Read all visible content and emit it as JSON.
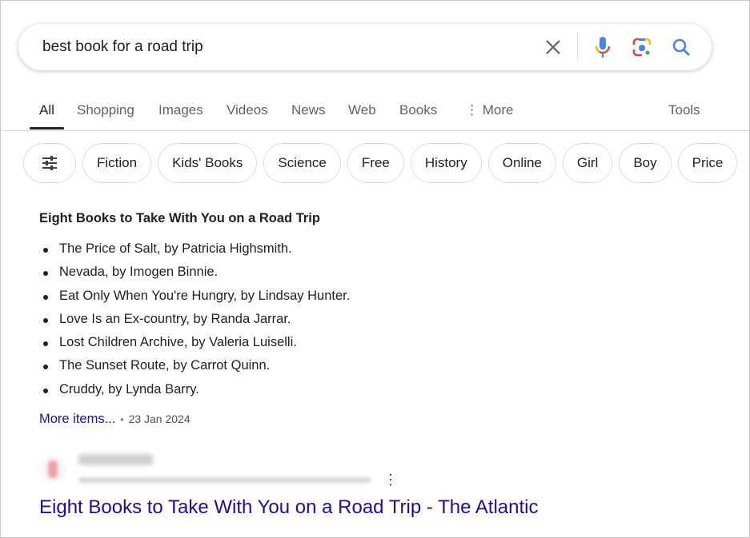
{
  "search": {
    "query": "best book for a road trip",
    "icons": [
      "close-icon",
      "mic-icon",
      "lens-icon",
      "search-icon"
    ]
  },
  "tabs": [
    {
      "label": "All",
      "active": true
    },
    {
      "label": "Shopping"
    },
    {
      "label": "Images"
    },
    {
      "label": "Videos"
    },
    {
      "label": "News"
    },
    {
      "label": "Web"
    },
    {
      "label": "Books"
    },
    {
      "label": "More"
    }
  ],
  "tools_label": "Tools",
  "chips": [
    "Fiction",
    "Kids' Books",
    "Science",
    "Free",
    "History",
    "Online",
    "Girl",
    "Boy",
    "Price"
  ],
  "snippet": {
    "heading": "Eight Books to Take With You on a Road Trip",
    "items": [
      "The Price of Salt, by Patricia Highsmith.",
      "Nevada, by Imogen Binnie.",
      "Eat Only When You're Hungry, by Lindsay Hunter.",
      "Love Is an Ex-country, by Randa Jarrar.",
      "Lost Children Archive, by Valeria Luiselli.",
      "The Sunset Route, by Carrot Quinn.",
      "Cruddy, by Lynda Barry."
    ],
    "more_label": "More items...",
    "date": "23 Jan 2024"
  },
  "result": {
    "title": "Eight Books to Take With You on a Road Trip - The Atlantic"
  },
  "colors": {
    "link": "#1a0dab",
    "google_blue": "#4285f4",
    "google_red": "#ea4335",
    "google_yellow": "#fbbc04",
    "google_green": "#34a853"
  }
}
